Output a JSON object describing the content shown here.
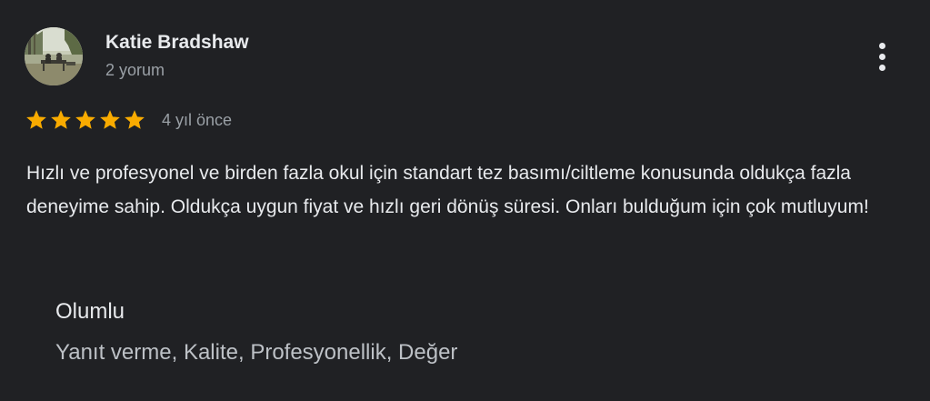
{
  "review": {
    "author_name": "Katie Bradshaw",
    "review_count": "2 yorum",
    "rating": 5,
    "rating_max": 5,
    "time_ago": "4 yıl önce",
    "text": "Hızlı ve profesyonel ve birden fazla okul için standart tez basımı/ciltleme konusunda oldukça fazla deneyime sahip. Oldukça uygun fiyat ve hızlı geri dönüş süresi. Onları bulduğum için çok mutluyum!",
    "positive": {
      "heading": "Olumlu",
      "values": "Yanıt verme, Kalite, Profesyonellik, Değer"
    }
  },
  "icons": {
    "avatar": "profile-photo",
    "more": "more-vert-icon",
    "star": "star-icon"
  },
  "colors": {
    "background": "#202124",
    "star": "#f9ab00",
    "primary_text": "#e8eaed",
    "secondary_text": "#9aa0a6"
  }
}
